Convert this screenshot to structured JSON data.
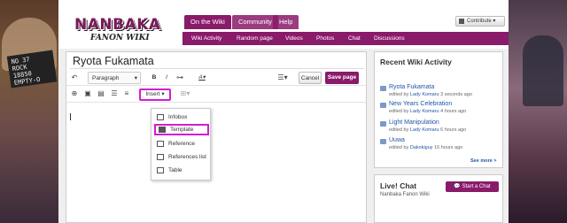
{
  "background": {
    "left_sign": "NO 37\nROCK\n18850\nEMPTY-O"
  },
  "logo": {
    "main": "NANBAKA",
    "sub": "FANON WIKI"
  },
  "tabs": [
    {
      "label": "On the Wiki"
    },
    {
      "label": "Community"
    },
    {
      "label": "Help"
    }
  ],
  "nav": [
    "Wiki Activity",
    "Random page",
    "Videos",
    "Photos",
    "Chat",
    "Discussions"
  ],
  "contribute": "Contribute",
  "editor": {
    "title": "Ryota Fukamata",
    "paragraph": "Paragraph",
    "bold": "B",
    "italic": "I",
    "color_a": "A",
    "cancel": "Cancel",
    "save": "Save page",
    "insert": "Insert"
  },
  "insert_menu": [
    {
      "label": "Infobox",
      "icon": "infobox-icon"
    },
    {
      "label": "Template",
      "icon": "template-icon",
      "highlighted": true
    },
    {
      "label": "Reference",
      "icon": "reference-icon"
    },
    {
      "label": "References list",
      "icon": "references-list-icon"
    },
    {
      "label": "Table",
      "icon": "table-icon"
    }
  ],
  "recent_activity": {
    "title": "Recent Wiki Activity",
    "items": [
      {
        "title": "Ryota Fukamata",
        "meta_pre": "edited by ",
        "user": "Lady Komaru",
        "meta_post": " 3 seconds ago"
      },
      {
        "title": "New Years Celebration",
        "meta_pre": "edited by ",
        "user": "Lady Komaru",
        "meta_post": " 4 hours ago"
      },
      {
        "title": "Light Manipulation",
        "meta_pre": "edited by ",
        "user": "Lady Komaru",
        "meta_post": " 6 hours ago"
      },
      {
        "title": "Uuwa",
        "meta_pre": "edited by ",
        "user": "Dakokiguy",
        "meta_post": " 16 hours ago"
      }
    ],
    "see_more": "See more >"
  },
  "chat": {
    "title": "Live! Chat",
    "sub": "Nanbaka Fanon Wiki",
    "button": "Start a Chat"
  },
  "colors": {
    "brand": "#8a1a6a",
    "highlight": "#d11ed1",
    "link": "#2255aa"
  }
}
